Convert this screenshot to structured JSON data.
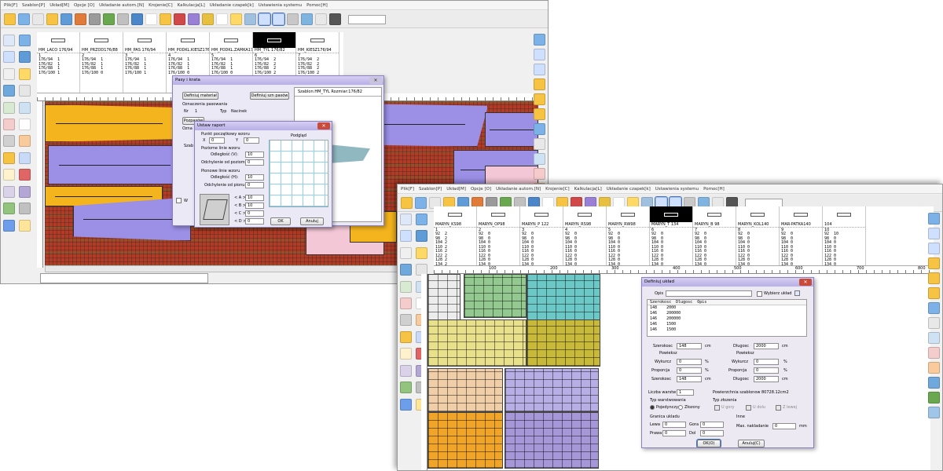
{
  "colors": {
    "purple_piece": "#9b8fe6",
    "yellow_piece": "#f4b41e",
    "fabric": "#b33a24",
    "dialog_title": "#b7aee6"
  },
  "win1": {
    "menu": [
      "Plik[F]",
      "Szablon[P]",
      "Układ[M]",
      "Opcje [O]",
      "Układanie autom.[N]",
      "Krojenie[C]",
      "Kalkulacja[L]",
      "Układanie czapek[k]",
      "Ustawienia systemu",
      "Pomoc[H]"
    ],
    "pieces": [
      {
        "name": "HM_LACO 176/94",
        "num": "1",
        "sizes": "176/94  1\n176/82  1\n176/88  1\n176/100 1"
      },
      {
        "name": "HM_PRZOD176/88",
        "num": "2",
        "sizes": "176/94  1\n176/82  1\n176/88  1\n176/100 0"
      },
      {
        "name": "HM_PAS 176/94",
        "num": "3",
        "sizes": "176/94  1\n176/82  1\n176/88  1\n176/100 1"
      },
      {
        "name": "HM_PODKL.KIESZ176/94",
        "num": "4",
        "sizes": "176/94  1\n176/82  1\n176/88  1\n176/100 0"
      },
      {
        "name": "HM_PODKL.ZAMKA176/9",
        "num": "5",
        "sizes": "176/94  1\n176/82  1\n176/88  1\n176/100 0"
      },
      {
        "name": "HM_TYL 176/82",
        "num": "6",
        "sizes": "176/94  2\n176/82  2\n176/88  2\n176/100 2"
      },
      {
        "name": "HM_KIESZ176/94",
        "num": "7",
        "sizes": "176/94  2\n176/82  2\n176/88  2\n176/100 2"
      }
    ],
    "pasy": {
      "title": "Pasy i krata",
      "btn_material": "Definiuj materiał",
      "btn_stripes": "Definiuj szn pasów",
      "section": "Oznaczenia pasowania",
      "nr_label": "Nr",
      "nr_value": "1",
      "typ_label": "Typ",
      "typ_value": "Nacinek",
      "preview_title": "Szablon:HM_TYL Rozmiar:176/82",
      "btn_pass": "Pozpasów",
      "btn_ok": "OK",
      "label_ozn": "Ozna",
      "label_szab": "Szab",
      "label_w": "W"
    },
    "raport": {
      "title": "Ustaw raport",
      "start_label": "Punkt początkowy wzoru",
      "x_label": "X",
      "x_value": "0",
      "y_label": "Y",
      "y_value": "0",
      "preview_label": "Podgląd",
      "hlines_label": "Poziome linie wzoru",
      "dist_v_label": "Odległość (V):",
      "dist_v_value": "10",
      "dev_h_label": "Odchylenie od poziomu (l):",
      "dev_h_value": "0",
      "vlines_label": "Pionowe linie wzoru",
      "dist_h_label": "Odległość (H):",
      "dist_h_value": "10",
      "dev_v_label": "Odchylenie od pionu (d):",
      "dev_v_value": "0",
      "a_label": "< A >",
      "a_value": "10",
      "b_label": "< B >",
      "b_value": "10",
      "c_label": "< C >",
      "c_value": "0",
      "d_label": "< D >",
      "d_value": "0",
      "ok": "OK",
      "cancel": "Anuluj"
    }
  },
  "win2": {
    "menu": [
      "Plik[F]",
      "Szablon[P]",
      "Układ[M]",
      "Opcje [O]",
      "Układanie autom.[N]",
      "Krojenie[C]",
      "Kalkulacja[L]",
      "Układanie czapek[k]",
      "Ustawienia systemu",
      "Pomoc[H]"
    ],
    "pieces": [
      {
        "name": "MARYN_KS98",
        "num": "1",
        "sizes": "92  2\n98  2\n104 2\n110 2\n116 2\n122 2\n128 2\n134 2\n140 2"
      },
      {
        "name": "MARYN_OP98",
        "num": "2",
        "sizes": "92  0\n98  0\n104 0\n110 0\n116 0\n122 0\n128 0\n134 0\n140 0"
      },
      {
        "name": "MARYN_P 122",
        "num": "3",
        "sizes": "92  0\n98  0\n104 0\n110 0\n116 0\n122 0\n128 0\n134 0\n140 0"
      },
      {
        "name": "MARYN_RS98",
        "num": "4",
        "sizes": "92  0\n98  0\n104 0\n110 0\n116 0\n122 0\n128 0\n134 0\n140 0"
      },
      {
        "name": "MARYN_RW98",
        "num": "5",
        "sizes": "92  0\n98  0\n104 0\n110 0\n116 0\n122 0\n128 0\n134 0\n140 0"
      },
      {
        "name": "MARYN_T 134",
        "num": "6",
        "sizes": "92  0\n98  0\n104 0\n110 0\n116 0\n122 0\n128 0\n134 0\n140 0"
      },
      {
        "name": "MARYN_B 98",
        "num": "7",
        "sizes": "92  0\n98  0\n104 0\n110 0\n116 0\n122 0\n128 0\n134 0\n140 0"
      },
      {
        "name": "MARYN_KOL140",
        "num": "8",
        "sizes": "92  0\n98  0\n104 0\n110 0\n116 0\n122 0\n128 0\n134 0\n140 0"
      },
      {
        "name": "MAR-PATKA140",
        "num": "9",
        "sizes": "92  0\n98  0\n104 0\n110 0\n116 0\n122 0\n128 0\n134 0\n140 0"
      },
      {
        "name": "104",
        "num": "10",
        "sizes": "92  10\n98  0\n104 0\n110 0\n116 0\n122 0\n128 0\n134 0\n140 0"
      }
    ],
    "ruler_labels": [
      "100",
      "200",
      "300",
      "400",
      "500",
      "600",
      "700",
      "800"
    ],
    "uklad": {
      "title": "Definiuj układ",
      "opis_label": "Opis",
      "wybierz_label": "Wybierz układ",
      "table_header": "Szerokosc  Dlugosc  Opis",
      "rows": [
        "148    2000",
        "146    200000",
        "146    200000",
        "146    1500",
        "146    1500"
      ],
      "szerokosc_label": "Szerokosc",
      "szerokosc_value": "148",
      "cm": "cm",
      "dlugosc_label": "Dlugosc",
      "dlugosc_value": "2000",
      "powiekszenie_label": "Powieksz",
      "wykurcz_label": "Wykurcz",
      "wykurcz_value": "0",
      "proporcja_label": "Proporcja",
      "proporcja_value": "0",
      "pct": "%",
      "szer2_value": "148",
      "dl2_value": "2000",
      "warstw_label": "Liczba warstw",
      "warstw_value": "1",
      "powierzchnia_label": "Powierzchnia szablonow",
      "powierzchnia_value": "80728.12cm2",
      "typ_warstw_label": "Typ warstwowania",
      "pojedynczy": "Pojedynczy",
      "zlozony": "Złozony",
      "typ_zlozenia_label": "Typ złozenia",
      "u_gory": "U gory",
      "u_dolu": "U dolu",
      "z_lewej": "Z lewej",
      "granica_label": "Granica ukladu",
      "lewa_label": "Lewa",
      "lewa_value": "0",
      "gora_label": "Gora",
      "gora_value": "0",
      "prawa_label": "Prawa",
      "prawa_value": "0",
      "dol_label": "Dol",
      "dol_value": "0",
      "inne_label": "Inne",
      "nakladanie_label": "Max. nakladanie",
      "nakladanie_value": "0",
      "mm": "mm",
      "ok": "OK(O)",
      "cancel": "Anuluj(C)"
    }
  }
}
